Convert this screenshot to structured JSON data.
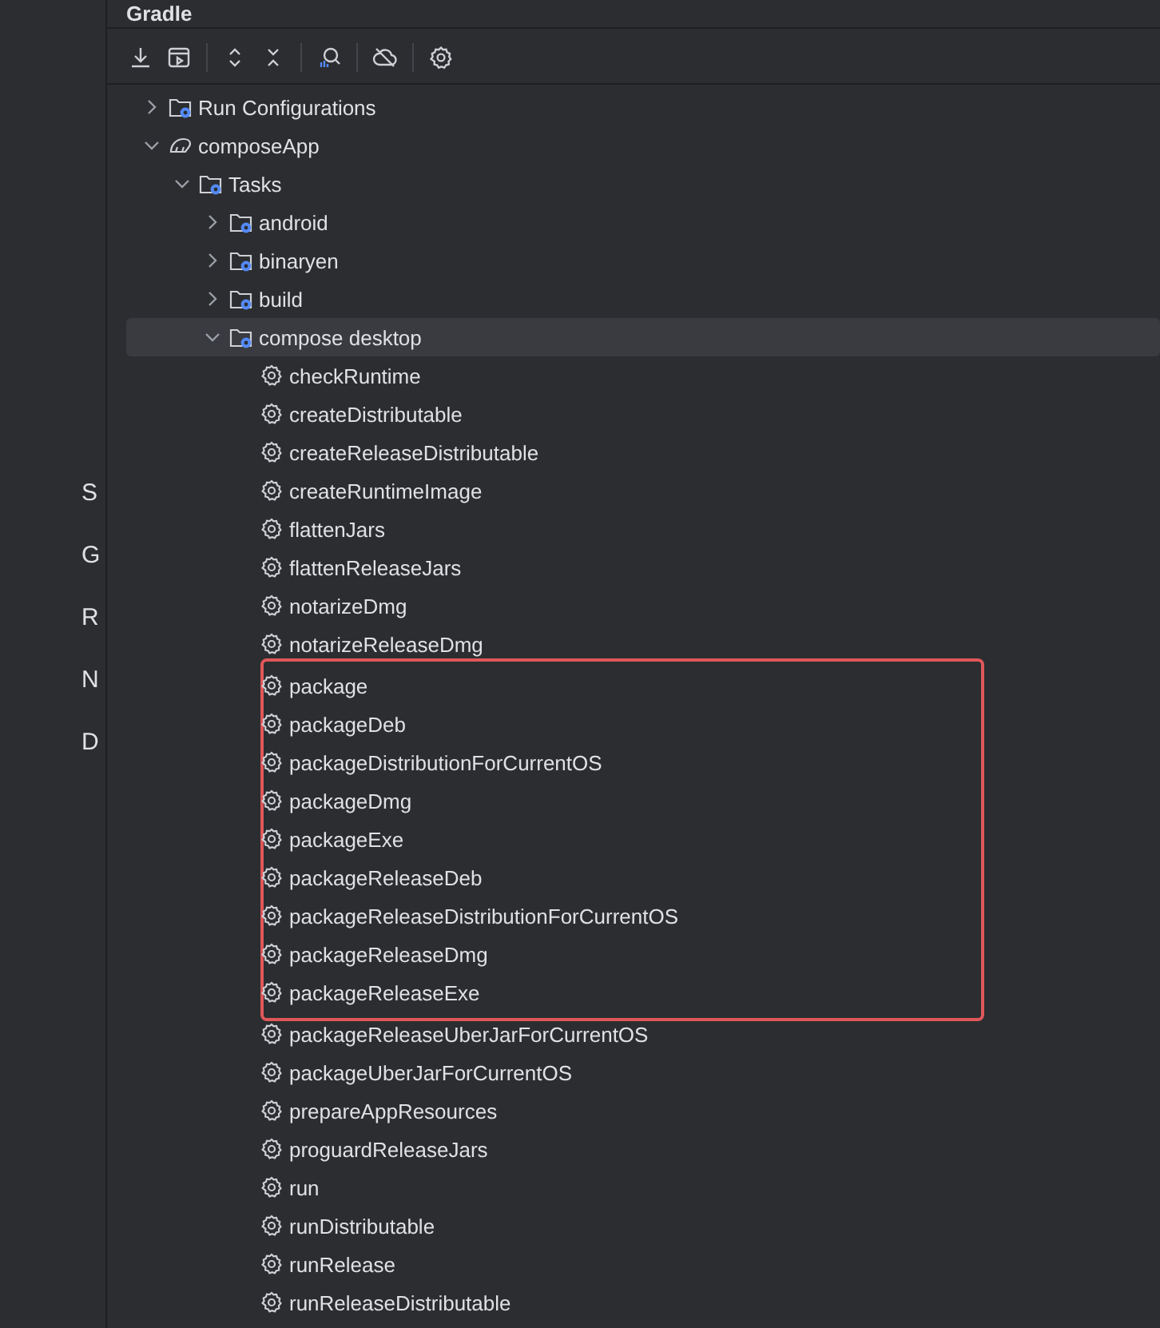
{
  "left_panel": {
    "items": [
      {
        "label": "S"
      },
      {
        "label": "G"
      },
      {
        "label": "R"
      },
      {
        "label": "N"
      },
      {
        "label": "D"
      }
    ]
  },
  "panel": {
    "title": "Gradle"
  },
  "toolbar": [
    {
      "kind": "download"
    },
    {
      "kind": "run-window"
    },
    {
      "kind": "expand"
    },
    {
      "kind": "collapse"
    },
    {
      "kind": "analyze"
    },
    {
      "kind": "offline"
    },
    {
      "kind": "settings"
    }
  ],
  "tree": [
    {
      "label": "Run Configurations",
      "kind": "folder",
      "expanded": false,
      "selected": false
    },
    {
      "label": "composeApp",
      "kind": "project",
      "expanded": true,
      "selected": false,
      "children": [
        {
          "label": "Tasks",
          "kind": "folder",
          "expanded": true,
          "selected": false,
          "children": [
            {
              "label": "android",
              "kind": "folder",
              "expanded": false,
              "selected": false
            },
            {
              "label": "binaryen",
              "kind": "folder",
              "expanded": false,
              "selected": false
            },
            {
              "label": "build",
              "kind": "folder",
              "expanded": false,
              "selected": false
            },
            {
              "label": "compose desktop",
              "kind": "folder",
              "expanded": true,
              "selected": true,
              "children": [
                {
                  "label": "checkRuntime",
                  "kind": "task",
                  "highlighted": false
                },
                {
                  "label": "createDistributable",
                  "kind": "task",
                  "highlighted": false
                },
                {
                  "label": "createReleaseDistributable",
                  "kind": "task",
                  "highlighted": false
                },
                {
                  "label": "createRuntimeImage",
                  "kind": "task",
                  "highlighted": false
                },
                {
                  "label": "flattenJars",
                  "kind": "task",
                  "highlighted": false
                },
                {
                  "label": "flattenReleaseJars",
                  "kind": "task",
                  "highlighted": false
                },
                {
                  "label": "notarizeDmg",
                  "kind": "task",
                  "highlighted": false
                },
                {
                  "label": "notarizeReleaseDmg",
                  "kind": "task",
                  "highlighted": false
                },
                {
                  "label": "package",
                  "kind": "task",
                  "highlighted": true
                },
                {
                  "label": "packageDeb",
                  "kind": "task",
                  "highlighted": true
                },
                {
                  "label": "packageDistributionForCurrentOS",
                  "kind": "task",
                  "highlighted": true
                },
                {
                  "label": "packageDmg",
                  "kind": "task",
                  "highlighted": true
                },
                {
                  "label": "packageExe",
                  "kind": "task",
                  "highlighted": true
                },
                {
                  "label": "packageReleaseDeb",
                  "kind": "task",
                  "highlighted": true
                },
                {
                  "label": "packageReleaseDistributionForCurrentOS",
                  "kind": "task",
                  "highlighted": true
                },
                {
                  "label": "packageReleaseDmg",
                  "kind": "task",
                  "highlighted": true
                },
                {
                  "label": "packageReleaseExe",
                  "kind": "task",
                  "highlighted": true
                },
                {
                  "label": "packageReleaseUberJarForCurrentOS",
                  "kind": "task",
                  "highlighted": false
                },
                {
                  "label": "packageUberJarForCurrentOS",
                  "kind": "task",
                  "highlighted": false
                },
                {
                  "label": "prepareAppResources",
                  "kind": "task",
                  "highlighted": false
                },
                {
                  "label": "proguardReleaseJars",
                  "kind": "task",
                  "highlighted": false
                },
                {
                  "label": "run",
                  "kind": "task",
                  "highlighted": false
                },
                {
                  "label": "runDistributable",
                  "kind": "task",
                  "highlighted": false
                },
                {
                  "label": "runRelease",
                  "kind": "task",
                  "highlighted": false
                },
                {
                  "label": "runReleaseDistributable",
                  "kind": "task",
                  "highlighted": false
                }
              ]
            }
          ]
        }
      ]
    }
  ]
}
